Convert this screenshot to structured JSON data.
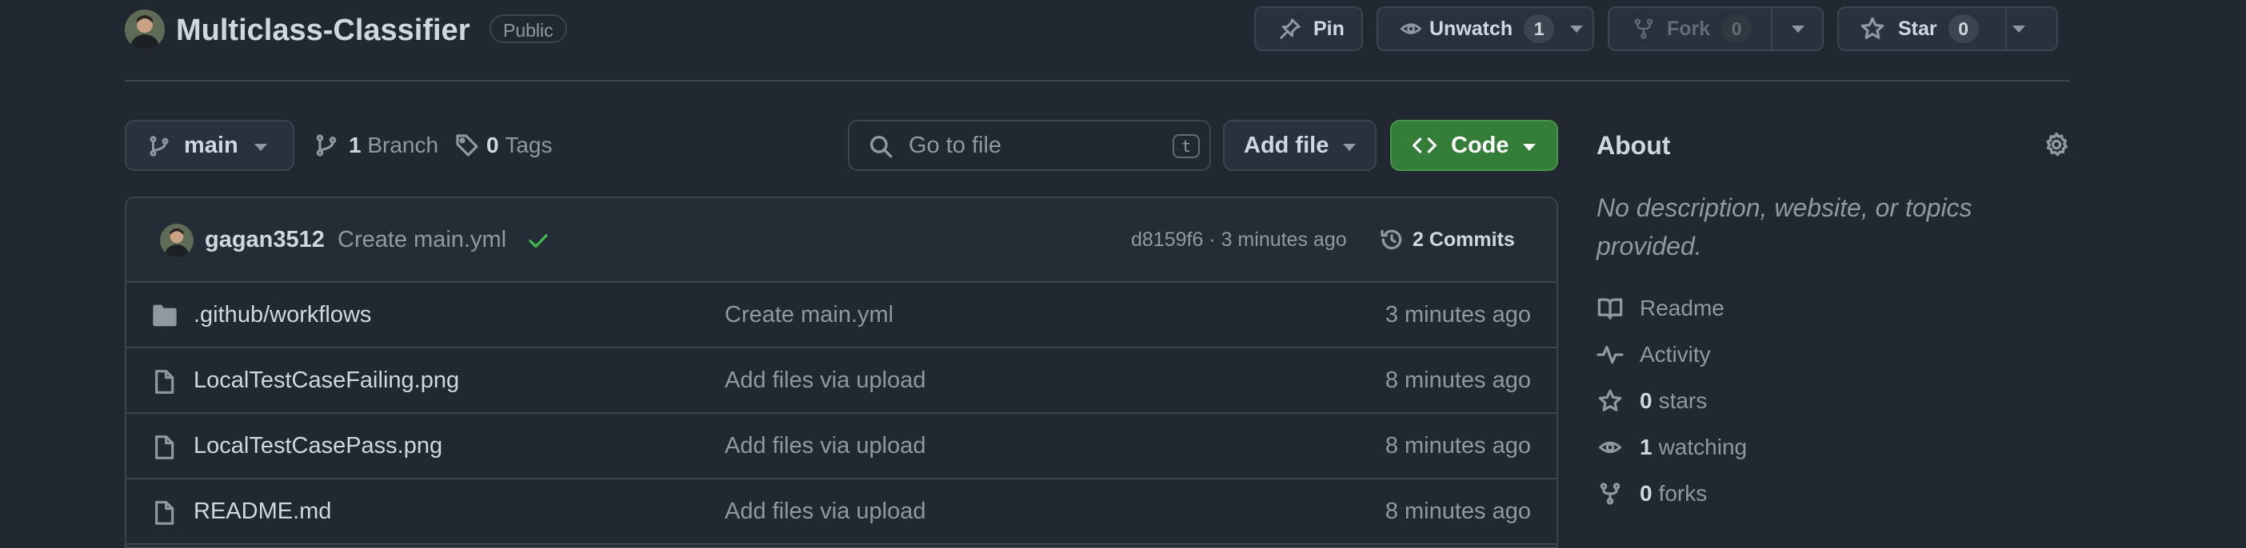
{
  "repo": {
    "name": "Multiclass-Classifier",
    "visibility": "Public"
  },
  "header_actions": {
    "pin": "Pin",
    "unwatch": {
      "label": "Unwatch",
      "count": "1"
    },
    "fork": {
      "label": "Fork",
      "count": "0"
    },
    "star": {
      "label": "Star",
      "count": "0"
    }
  },
  "toolbar": {
    "branch": "main",
    "branches": {
      "count": "1",
      "label": "Branch"
    },
    "tags": {
      "count": "0",
      "label": "Tags"
    },
    "search_placeholder": "Go to file",
    "search_shortcut": "t",
    "add_file": "Add file",
    "code": "Code"
  },
  "last_commit": {
    "author": "gagan3512",
    "message": "Create main.yml",
    "hash_time": "d8159f6 · 3 minutes ago",
    "commits_label": "2 Commits"
  },
  "files": [
    {
      "type": "folder",
      "name": ".github/workflows",
      "message": "Create main.yml",
      "time": "3 minutes ago"
    },
    {
      "type": "file",
      "name": "LocalTestCaseFailing.png",
      "message": "Add files via upload",
      "time": "8 minutes ago"
    },
    {
      "type": "file",
      "name": "LocalTestCasePass.png",
      "message": "Add files via upload",
      "time": "8 minutes ago"
    },
    {
      "type": "file",
      "name": "README.md",
      "message": "Add files via upload",
      "time": "8 minutes ago"
    }
  ],
  "about": {
    "title": "About",
    "description": "No description, website, or topics provided.",
    "readme": "Readme",
    "activity": "Activity",
    "stars": {
      "count": "0",
      "label": "stars"
    },
    "watching": {
      "count": "1",
      "label": "watching"
    },
    "forks": {
      "count": "0",
      "label": "forks"
    }
  },
  "colors": {
    "accent_green": "#347d39",
    "check_green": "#3fb950",
    "background": "#212830"
  }
}
